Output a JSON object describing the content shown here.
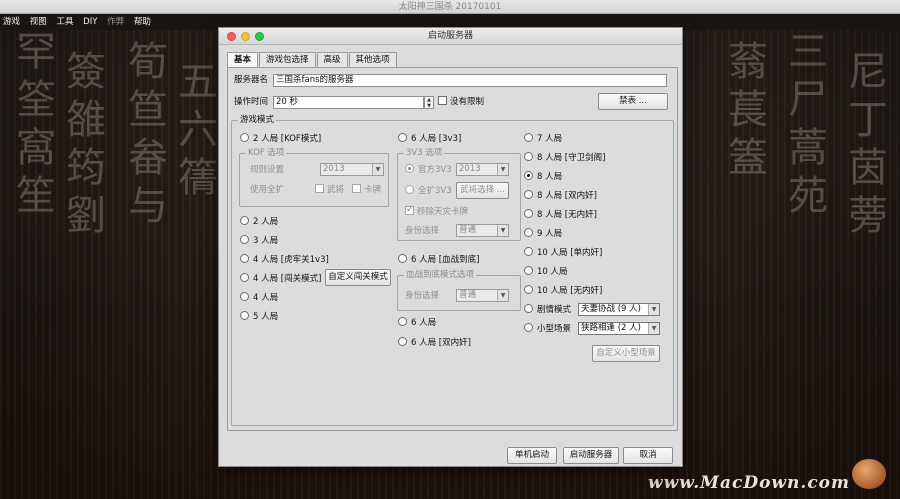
{
  "window": {
    "title": "太阳神三国杀 20170101"
  },
  "menu": [
    "游戏",
    "视图",
    "工具",
    "DIY",
    "作弊",
    "帮助"
  ],
  "dialog": {
    "title": "启动服务器",
    "tabs": [
      "基本",
      "游戏包选择",
      "高级",
      "其他选项"
    ],
    "server_name_label": "服务器名",
    "server_name_value": "三国杀fans的服务器",
    "op_time_label": "操作时间",
    "op_time_value": "20 秒",
    "no_limit_label": "没有限制",
    "ban_button": "禁表 ...",
    "mode_group_label": "游戏模式",
    "kof_group_label": "KOF 选项",
    "kof_rule_label": "规则设置",
    "kof_rule_value": "2013",
    "kof_ext_label": "使用全扩",
    "kof_general": "武将",
    "kof_card": "卡牌",
    "v3_group_label": "3V3 选项",
    "v3_official": "官方3V3",
    "v3_official_value": "2013",
    "v3_full": "全扩3V3",
    "v3_select_button": "武将选择 ...",
    "v3_remove_card": "移除天灾卡牌",
    "v3_role_label": "身份选择",
    "v3_role_value": "普通",
    "bdd_group_label": "血战到底模式选项",
    "bdd_role_label": "身份选择",
    "bdd_role_value": "普通",
    "col1": [
      "2 人局 [KOF模式]",
      "2 人局",
      "3 人局",
      "4 人局 [虎牢关1v3]",
      "4 人局 [闯关模式]",
      "4 人局",
      "5 人局"
    ],
    "custom_pass_button": "自定义闯关模式",
    "col2": [
      "6 人局 [3v3]",
      "6 人局 [血战到底]",
      "6 人局",
      "6 人局 [双内奸]"
    ],
    "col3": [
      "7 人局",
      "8 人局 [守卫剑阁]",
      "8 人局",
      "8 人局 [双内奸]",
      "8 人局 [无内奸]",
      "9 人局",
      "10 人局 [单内奸]",
      "10 人局",
      "10 人局 [无内奸]",
      "剧情模式",
      "小型场景"
    ],
    "scenario_value": "夫妻协战 (9 人)",
    "mini_value": "狭路相逢 (2 人)",
    "custom_mini_button": "自定义小型场景",
    "footer": {
      "single_button": "单机启动",
      "start_button": "启动服务器",
      "cancel_button": "取消"
    }
  },
  "watermark": "www.MacDown.com"
}
